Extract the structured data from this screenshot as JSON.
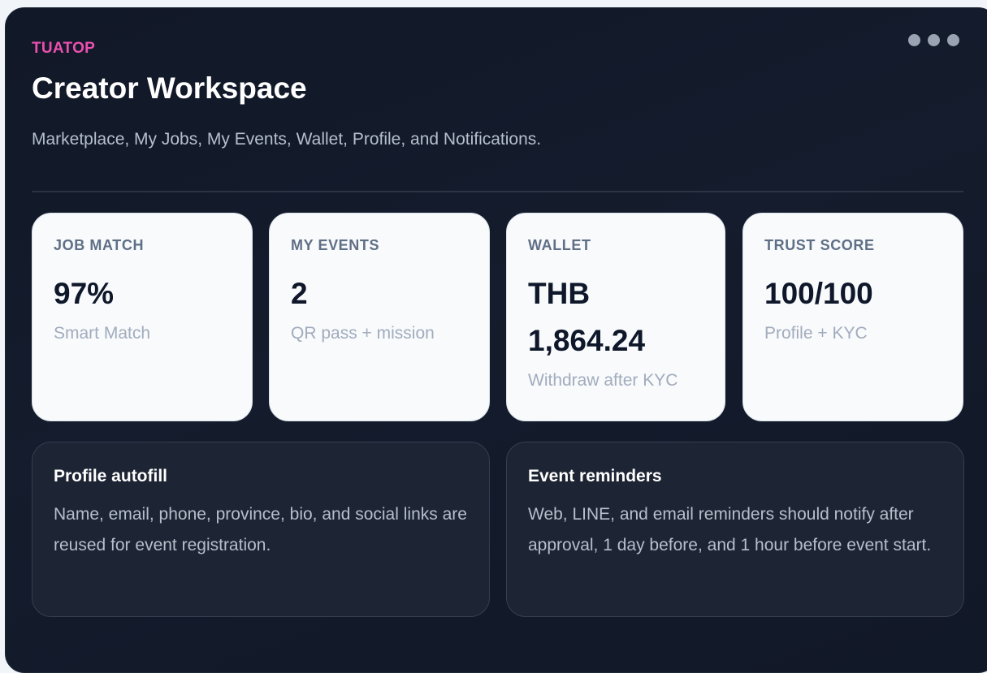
{
  "brand": "TUATOP",
  "title": "Creator Workspace",
  "subtitle": "Marketplace, My Jobs, My Events, Wallet, Profile, and Notifications.",
  "stats": [
    {
      "label": "JOB MATCH",
      "value": "97%",
      "note": "Smart Match"
    },
    {
      "label": "MY EVENTS",
      "value": "2",
      "note": "QR pass + mission"
    },
    {
      "label": "WALLET",
      "value": "THB 1,864.24",
      "note": "Withdraw after KYC"
    },
    {
      "label": "TRUST SCORE",
      "value": "100/100",
      "note": "Profile + KYC"
    }
  ],
  "info": [
    {
      "title": "Profile autofill",
      "text": "Name, email, phone, province, bio, and social links are reused for event registration."
    },
    {
      "title": "Event reminders",
      "text": "Web, LINE, and email reminders should notify after approval, 1 day before, and 1 hour before event start."
    }
  ],
  "colors": {
    "brand": "#ec4fb0",
    "panel_bg": "#111827",
    "card_bg": "#f8fafc"
  },
  "icons": {
    "menu": "more-dots-icon"
  }
}
